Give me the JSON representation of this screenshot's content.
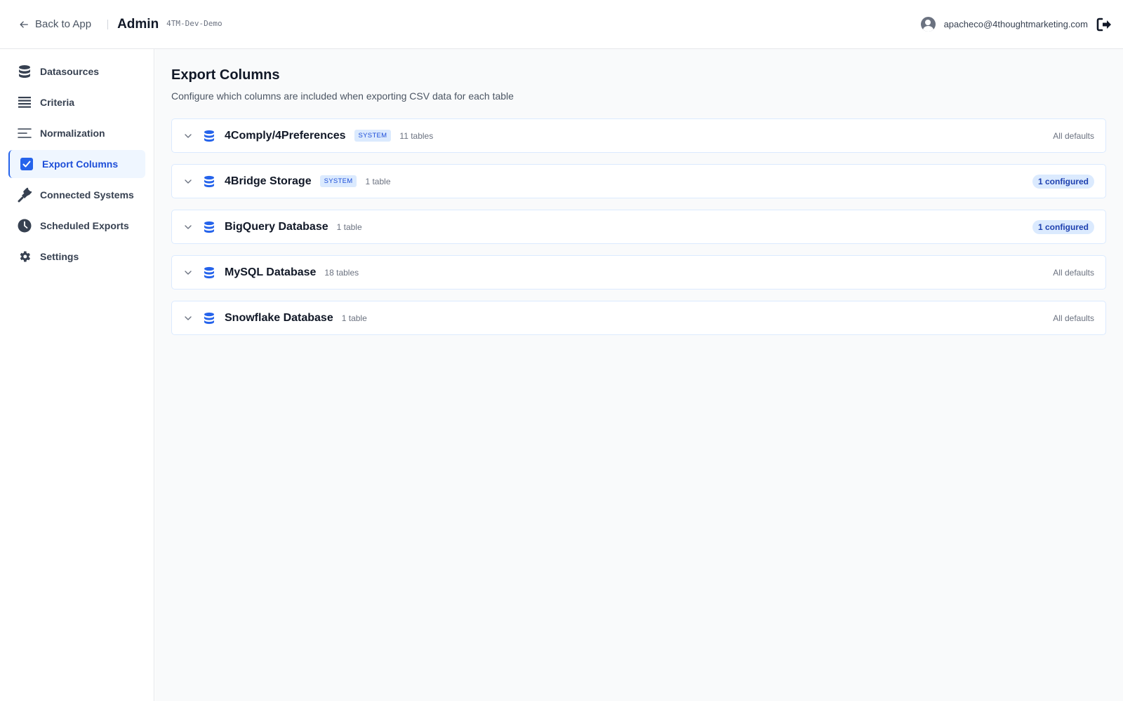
{
  "header": {
    "back_label": "Back to App",
    "title": "Admin",
    "environment": "4TM-Dev-Demo",
    "user_email": "apacheco@4thoughtmarketing.com"
  },
  "sidebar": {
    "items": [
      {
        "label": "Datasources",
        "icon": "database-icon",
        "active": false
      },
      {
        "label": "Criteria",
        "icon": "list-icon",
        "active": false
      },
      {
        "label": "Normalization",
        "icon": "align-left-icon",
        "active": false
      },
      {
        "label": "Export Columns",
        "icon": "checkbox-icon",
        "active": true
      },
      {
        "label": "Connected Systems",
        "icon": "plug-icon",
        "active": false
      },
      {
        "label": "Scheduled Exports",
        "icon": "clock-icon",
        "active": false
      },
      {
        "label": "Settings",
        "icon": "gear-icon",
        "active": false
      }
    ]
  },
  "main": {
    "title": "Export Columns",
    "subtitle": "Configure which columns are included when exporting CSV data for each table",
    "datasources": [
      {
        "name": "4Comply/4Preferences",
        "badge": "SYSTEM",
        "count": "11 tables",
        "status": "All defaults",
        "configured": false
      },
      {
        "name": "4Bridge Storage",
        "badge": "SYSTEM",
        "count": "1 table",
        "status": "1 configured",
        "configured": true
      },
      {
        "name": "BigQuery Database",
        "badge": "",
        "count": "1 table",
        "status": "1 configured",
        "configured": true
      },
      {
        "name": "MySQL Database",
        "badge": "",
        "count": "18 tables",
        "status": "All defaults",
        "configured": false
      },
      {
        "name": "Snowflake Database",
        "badge": "",
        "count": "1 table",
        "status": "All defaults",
        "configured": false
      }
    ]
  },
  "colors": {
    "accent": "#2563eb",
    "active_bg": "#eff6ff",
    "badge_bg": "#dbeafe",
    "main_bg": "#f9fafb"
  }
}
